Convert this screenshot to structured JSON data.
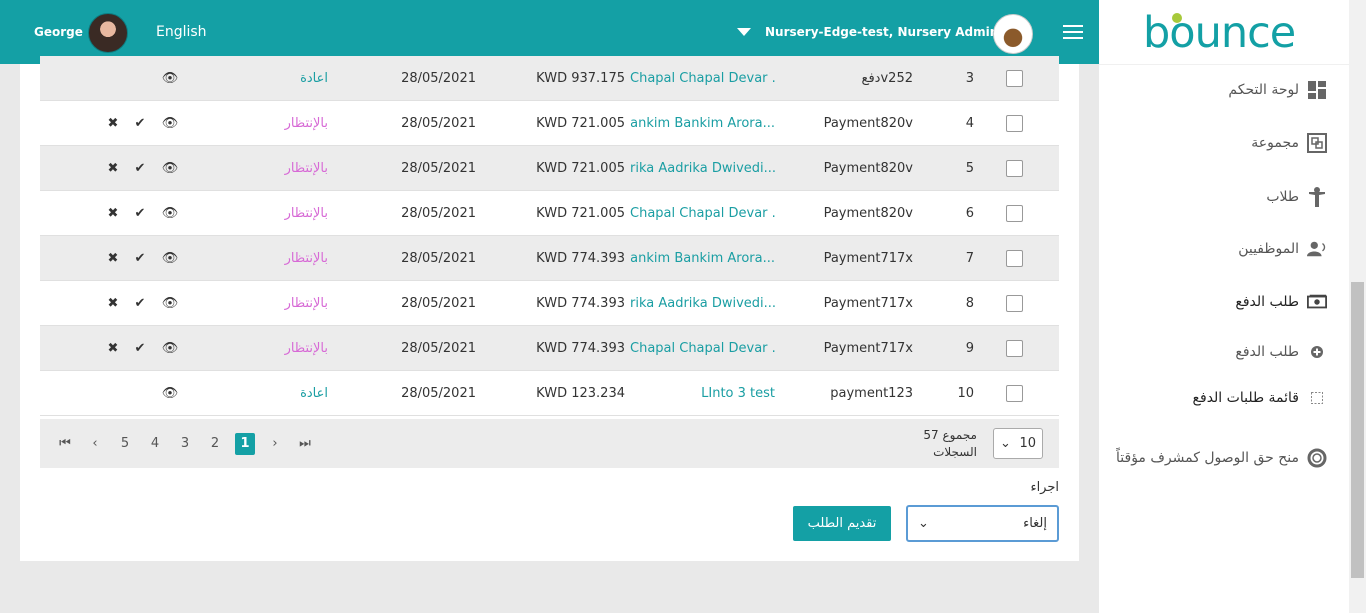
{
  "topbar": {
    "user_name": "George",
    "language": "English",
    "nursery_label": "Nursery-Edge-test, Nursery Admin"
  },
  "logo": {
    "text": "bounce"
  },
  "sidebar": {
    "items": [
      {
        "label": "لوحة التحكم",
        "icon": "dashboard-icon"
      },
      {
        "label": "مجموعة",
        "icon": "group-icon"
      },
      {
        "label": "طلاب",
        "icon": "student-icon"
      },
      {
        "label": "الموظفيين",
        "icon": "staff-icon"
      },
      {
        "label": "طلب الدفع",
        "icon": "payment-icon"
      },
      {
        "label": "طلب الدفع",
        "icon": "add-circle-icon"
      },
      {
        "label": "قائمة طلبات الدفع",
        "icon": "list-icon"
      },
      {
        "label": "منح حق الوصول كمشرف مؤقتاً",
        "icon": "lifebuoy-icon"
      }
    ]
  },
  "table": {
    "rows": [
      {
        "num": "3",
        "ref": "دفعv252",
        "name": "Chapal Chapal Devar ...",
        "amount": "KWD 937.175",
        "date": "28/05/2021",
        "status": "اعادة",
        "status_type": "resend",
        "actions": [
          "view"
        ]
      },
      {
        "num": "4",
        "ref": "Payment820v",
        "name": "ankim Bankim Arora...",
        "amount": "KWD 721.005",
        "date": "28/05/2021",
        "status": "بالإنتظار",
        "status_type": "pending",
        "actions": [
          "view",
          "approve",
          "reject"
        ]
      },
      {
        "num": "5",
        "ref": "Payment820v",
        "name": "rika Aadrika Dwivedi...",
        "amount": "KWD 721.005",
        "date": "28/05/2021",
        "status": "بالإنتظار",
        "status_type": "pending",
        "actions": [
          "view",
          "approve",
          "reject"
        ]
      },
      {
        "num": "6",
        "ref": "Payment820v",
        "name": "Chapal Chapal Devar ...",
        "amount": "KWD 721.005",
        "date": "28/05/2021",
        "status": "بالإنتظار",
        "status_type": "pending",
        "actions": [
          "view",
          "approve",
          "reject"
        ]
      },
      {
        "num": "7",
        "ref": "Payment717x",
        "name": "ankim Bankim Arora...",
        "amount": "KWD 774.393",
        "date": "28/05/2021",
        "status": "بالإنتظار",
        "status_type": "pending",
        "actions": [
          "view",
          "approve",
          "reject"
        ]
      },
      {
        "num": "8",
        "ref": "Payment717x",
        "name": "rika Aadrika Dwivedi...",
        "amount": "KWD 774.393",
        "date": "28/05/2021",
        "status": "بالإنتظار",
        "status_type": "pending",
        "actions": [
          "view",
          "approve",
          "reject"
        ]
      },
      {
        "num": "9",
        "ref": "Payment717x",
        "name": "Chapal Chapal Devar ...",
        "amount": "KWD 774.393",
        "date": "28/05/2021",
        "status": "بالإنتظار",
        "status_type": "pending",
        "actions": [
          "view",
          "approve",
          "reject"
        ]
      },
      {
        "num": "10",
        "ref": "payment123",
        "name": "LInto 3 test",
        "amount": "KWD 123.234",
        "date": "28/05/2021",
        "status": "اعادة",
        "status_type": "resend",
        "actions": [
          "view"
        ]
      }
    ]
  },
  "pager": {
    "total_label_line1": "57 مجموع",
    "total_label_line2": "السجلات",
    "page_size": "10",
    "pages": [
      "1",
      "2",
      "3",
      "4",
      "5"
    ],
    "current_page": "1"
  },
  "action": {
    "label": "اجراء",
    "selected_option": "إلغاء",
    "submit_label": "تقديم الطلب"
  },
  "colors": {
    "accent": "#14a0a5",
    "pending": "#d76ad6",
    "logo_dot": "#a7c93a"
  }
}
